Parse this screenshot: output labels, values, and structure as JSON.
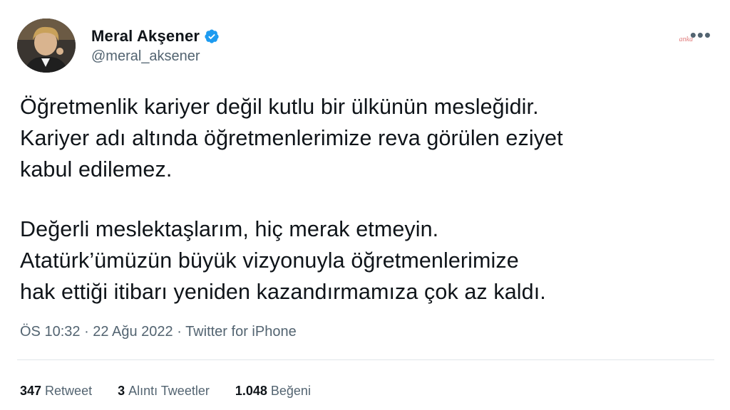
{
  "author": {
    "name": "Meral Akşener",
    "handle": "@meral_aksener",
    "verified": true
  },
  "watermark": "anka",
  "more_icon": "more-horizontal-icon",
  "tweet": {
    "paragraphs": [
      [
        "Öğretmenlik kariyer değil kutlu bir ülkünün mesleğidir.",
        "Kariyer adı altında öğretmenlerimize reva görülen eziyet",
        "kabul edilemez."
      ],
      [
        "Değerli meslektaşlarım, hiç merak etmeyin.",
        "Atatürk’ümüzün büyük vizyonuyla öğretmenlerimize",
        "hak ettiği itibarı yeniden kazandırmamıza çok az kaldı."
      ]
    ]
  },
  "meta": {
    "time": "ÖS 10:32",
    "date": "22 Ağu 2022",
    "source": "Twitter for iPhone",
    "separator": "·"
  },
  "stats": {
    "retweets": {
      "count": "347",
      "label": "Retweet"
    },
    "quotes": {
      "count": "3",
      "label": "Alıntı Tweetler"
    },
    "likes": {
      "count": "1.048",
      "label": "Beğeni"
    }
  },
  "colors": {
    "text": "#0f1419",
    "secondary": "#536471",
    "verified": "#1d9bf0",
    "divider": "#e1e6ea"
  }
}
